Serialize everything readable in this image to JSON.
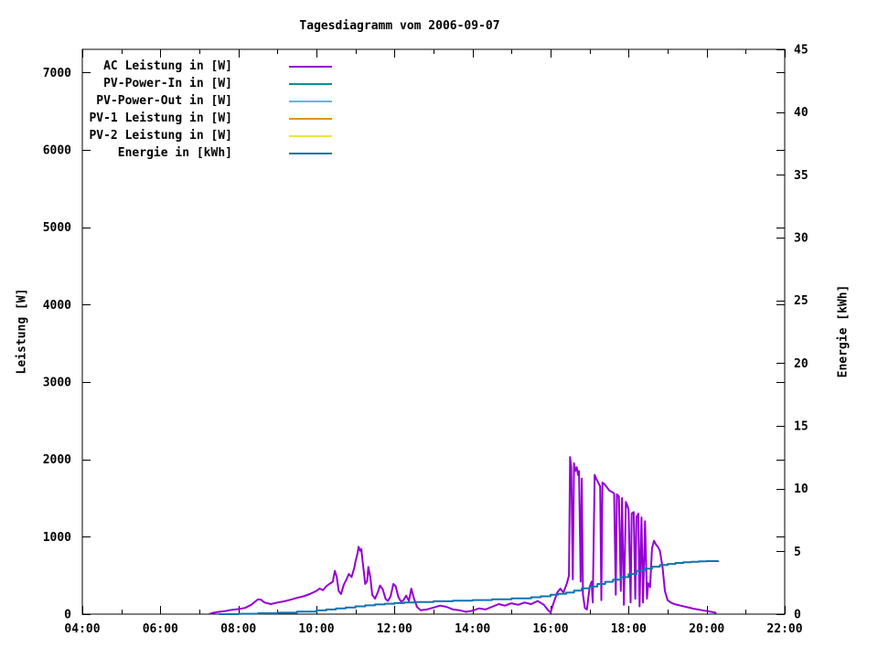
{
  "title": "Tagesdiagramm vom 2006-09-07",
  "axes": {
    "x": {
      "min": 4,
      "max": 22,
      "minor_step": 1,
      "major_ticks": [
        4,
        6,
        8,
        10,
        12,
        14,
        16,
        18,
        20,
        22
      ],
      "labels": [
        "04:00",
        "06:00",
        "08:00",
        "10:00",
        "12:00",
        "14:00",
        "16:00",
        "18:00",
        "20:00",
        "22:00"
      ]
    },
    "y_left": {
      "label": "Leistung [W]",
      "min": 0,
      "max": 7300,
      "major_ticks": [
        0,
        1000,
        2000,
        3000,
        4000,
        5000,
        6000,
        7000
      ],
      "labels": [
        "0",
        "1000",
        "2000",
        "3000",
        "4000",
        "5000",
        "6000",
        "7000"
      ]
    },
    "y_right": {
      "label": "Energie [kWh]",
      "min": 0,
      "max": 45,
      "major_ticks": [
        0,
        5,
        10,
        15,
        20,
        25,
        30,
        35,
        40,
        45
      ],
      "labels": [
        "0",
        "5",
        "10",
        "15",
        "20",
        "25",
        "30",
        "35",
        "40",
        "45"
      ]
    }
  },
  "chart_data": {
    "type": "line",
    "title": "Tagesdiagramm vom 2006-09-07",
    "x_range": [
      4,
      22
    ],
    "y_left_range": [
      0,
      7300
    ],
    "y_right_range": [
      0,
      45
    ],
    "grid": false,
    "legend_position": "top-left-inside",
    "series": [
      {
        "name": "AC Leistung in [W]",
        "color": "#9400d3",
        "axis": "left",
        "style": "line",
        "points": [
          [
            7.25,
            0
          ],
          [
            7.33,
            15
          ],
          [
            7.5,
            30
          ],
          [
            7.67,
            40
          ],
          [
            7.83,
            55
          ],
          [
            8.0,
            65
          ],
          [
            8.17,
            80
          ],
          [
            8.33,
            120
          ],
          [
            8.5,
            190
          ],
          [
            8.58,
            185
          ],
          [
            8.67,
            150
          ],
          [
            8.83,
            130
          ],
          [
            9.0,
            150
          ],
          [
            9.17,
            165
          ],
          [
            9.33,
            185
          ],
          [
            9.5,
            210
          ],
          [
            9.67,
            230
          ],
          [
            9.83,
            260
          ],
          [
            10.0,
            300
          ],
          [
            10.08,
            330
          ],
          [
            10.17,
            310
          ],
          [
            10.25,
            360
          ],
          [
            10.33,
            390
          ],
          [
            10.42,
            420
          ],
          [
            10.47,
            560
          ],
          [
            10.52,
            480
          ],
          [
            10.57,
            300
          ],
          [
            10.63,
            260
          ],
          [
            10.7,
            380
          ],
          [
            10.77,
            450
          ],
          [
            10.83,
            520
          ],
          [
            10.9,
            480
          ],
          [
            10.97,
            600
          ],
          [
            11.0,
            680
          ],
          [
            11.05,
            780
          ],
          [
            11.08,
            870
          ],
          [
            11.12,
            820
          ],
          [
            11.15,
            840
          ],
          [
            11.18,
            700
          ],
          [
            11.22,
            520
          ],
          [
            11.25,
            390
          ],
          [
            11.3,
            430
          ],
          [
            11.33,
            610
          ],
          [
            11.38,
            480
          ],
          [
            11.43,
            250
          ],
          [
            11.5,
            200
          ],
          [
            11.57,
            280
          ],
          [
            11.63,
            370
          ],
          [
            11.7,
            320
          ],
          [
            11.77,
            200
          ],
          [
            11.83,
            170
          ],
          [
            11.9,
            230
          ],
          [
            11.97,
            390
          ],
          [
            12.03,
            360
          ],
          [
            12.1,
            220
          ],
          [
            12.17,
            160
          ],
          [
            12.23,
            180
          ],
          [
            12.3,
            240
          ],
          [
            12.37,
            170
          ],
          [
            12.43,
            330
          ],
          [
            12.5,
            200
          ],
          [
            12.58,
            90
          ],
          [
            12.67,
            50
          ],
          [
            12.83,
            60
          ],
          [
            13.0,
            85
          ],
          [
            13.17,
            110
          ],
          [
            13.33,
            95
          ],
          [
            13.5,
            60
          ],
          [
            13.67,
            50
          ],
          [
            13.83,
            30
          ],
          [
            14.0,
            45
          ],
          [
            14.17,
            75
          ],
          [
            14.33,
            60
          ],
          [
            14.5,
            95
          ],
          [
            14.67,
            130
          ],
          [
            14.83,
            110
          ],
          [
            15.0,
            140
          ],
          [
            15.17,
            120
          ],
          [
            15.33,
            150
          ],
          [
            15.5,
            130
          ],
          [
            15.67,
            170
          ],
          [
            15.83,
            120
          ],
          [
            15.92,
            60
          ],
          [
            16.0,
            20
          ],
          [
            16.08,
            150
          ],
          [
            16.17,
            280
          ],
          [
            16.25,
            330
          ],
          [
            16.33,
            280
          ],
          [
            16.42,
            400
          ],
          [
            16.47,
            500
          ],
          [
            16.5,
            2030
          ],
          [
            16.53,
            1900
          ],
          [
            16.57,
            450
          ],
          [
            16.6,
            1950
          ],
          [
            16.63,
            1850
          ],
          [
            16.67,
            1900
          ],
          [
            16.7,
            1800
          ],
          [
            16.73,
            1850
          ],
          [
            16.77,
            420
          ],
          [
            16.8,
            1750
          ],
          [
            16.83,
            250
          ],
          [
            16.88,
            80
          ],
          [
            16.93,
            60
          ],
          [
            17.0,
            350
          ],
          [
            17.05,
            420
          ],
          [
            17.08,
            150
          ],
          [
            17.13,
            1800
          ],
          [
            17.17,
            1750
          ],
          [
            17.22,
            1700
          ],
          [
            17.27,
            1650
          ],
          [
            17.3,
            180
          ],
          [
            17.33,
            1700
          ],
          [
            17.38,
            1680
          ],
          [
            17.43,
            1650
          ],
          [
            17.5,
            1600
          ],
          [
            17.57,
            1580
          ],
          [
            17.63,
            1560
          ],
          [
            17.67,
            250
          ],
          [
            17.7,
            1550
          ],
          [
            17.75,
            1520
          ],
          [
            17.8,
            300
          ],
          [
            17.83,
            1500
          ],
          [
            17.88,
            120
          ],
          [
            17.93,
            1450
          ],
          [
            17.97,
            1400
          ],
          [
            18.0,
            1350
          ],
          [
            18.05,
            150
          ],
          [
            18.08,
            1300
          ],
          [
            18.13,
            1320
          ],
          [
            18.17,
            200
          ],
          [
            18.2,
            1250
          ],
          [
            18.25,
            1300
          ],
          [
            18.28,
            100
          ],
          [
            18.33,
            1250
          ],
          [
            18.37,
            150
          ],
          [
            18.42,
            1200
          ],
          [
            18.47,
            200
          ],
          [
            18.5,
            400
          ],
          [
            18.55,
            350
          ],
          [
            18.6,
            850
          ],
          [
            18.65,
            950
          ],
          [
            18.7,
            900
          ],
          [
            18.75,
            870
          ],
          [
            18.8,
            820
          ],
          [
            18.87,
            600
          ],
          [
            18.93,
            300
          ],
          [
            19.0,
            180
          ],
          [
            19.08,
            150
          ],
          [
            19.17,
            130
          ],
          [
            19.33,
            110
          ],
          [
            19.5,
            90
          ],
          [
            19.67,
            70
          ],
          [
            19.83,
            55
          ],
          [
            20.0,
            40
          ],
          [
            20.17,
            25
          ],
          [
            20.25,
            15
          ]
        ]
      },
      {
        "name": "PV-Power-In in [W]",
        "color": "#009393",
        "axis": "left",
        "style": "line",
        "points": []
      },
      {
        "name": "PV-Power-Out in [W]",
        "color": "#5cb8e8",
        "axis": "left",
        "style": "line",
        "points": []
      },
      {
        "name": "PV-1 Leistung in [W]",
        "color": "#dd9800",
        "axis": "left",
        "style": "line",
        "points": []
      },
      {
        "name": "PV-2 Leistung in [W]",
        "color": "#ede53c",
        "axis": "left",
        "style": "line",
        "points": []
      },
      {
        "name": "Energie in [kWh]",
        "color": "#1073b0",
        "axis": "right",
        "style": "step",
        "points": [
          [
            7.5,
            0
          ],
          [
            8.0,
            0.03
          ],
          [
            8.5,
            0.07
          ],
          [
            9.0,
            0.12
          ],
          [
            9.5,
            0.2
          ],
          [
            10.0,
            0.3
          ],
          [
            10.25,
            0.37
          ],
          [
            10.5,
            0.45
          ],
          [
            10.75,
            0.53
          ],
          [
            11.0,
            0.62
          ],
          [
            11.25,
            0.7
          ],
          [
            11.5,
            0.77
          ],
          [
            11.75,
            0.83
          ],
          [
            12.0,
            0.88
          ],
          [
            12.25,
            0.93
          ],
          [
            12.5,
            0.97
          ],
          [
            13.0,
            1.03
          ],
          [
            13.5,
            1.08
          ],
          [
            14.0,
            1.12
          ],
          [
            14.5,
            1.18
          ],
          [
            15.0,
            1.25
          ],
          [
            15.5,
            1.35
          ],
          [
            15.75,
            1.42
          ],
          [
            16.0,
            1.55
          ],
          [
            16.2,
            1.62
          ],
          [
            16.4,
            1.72
          ],
          [
            16.6,
            1.88
          ],
          [
            16.8,
            2.05
          ],
          [
            17.0,
            2.2
          ],
          [
            17.2,
            2.4
          ],
          [
            17.4,
            2.58
          ],
          [
            17.6,
            2.75
          ],
          [
            17.8,
            2.95
          ],
          [
            18.0,
            3.2
          ],
          [
            18.2,
            3.45
          ],
          [
            18.4,
            3.62
          ],
          [
            18.6,
            3.78
          ],
          [
            18.8,
            3.92
          ],
          [
            19.0,
            4.0
          ],
          [
            19.2,
            4.08
          ],
          [
            19.4,
            4.13
          ],
          [
            19.6,
            4.17
          ],
          [
            19.8,
            4.2
          ],
          [
            20.0,
            4.22
          ],
          [
            20.3,
            4.25
          ]
        ]
      }
    ]
  }
}
